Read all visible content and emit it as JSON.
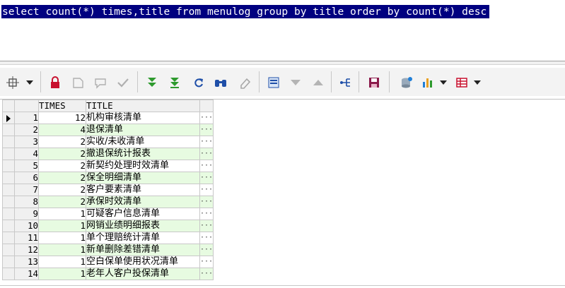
{
  "sql": {
    "query": "select count(*) times,title from menulog group by title order by count(*) desc"
  },
  "toolbar": {
    "icons": [
      "query-settings-icon",
      "lock-icon",
      "new-record-icon",
      "delete-record-icon",
      "post-changes-icon",
      "fetch-next-icon",
      "fetch-last-icon",
      "refresh-icon",
      "find-icon",
      "clear-icon",
      "single-record-icon",
      "sort-desc-icon",
      "sort-asc-icon",
      "export-icon",
      "save-icon",
      "query-by-example-icon",
      "chart-icon",
      "table-view-icon"
    ],
    "accent_green": "#2e9a2e",
    "accent_red": "#c8102e",
    "accent_blue": "#1f4fa8"
  },
  "grid": {
    "columns": [
      "TIMES",
      "TITLE"
    ],
    "rows": [
      {
        "n": "1",
        "times": "12",
        "title": "机构审核清单"
      },
      {
        "n": "2",
        "times": "4",
        "title": "退保清单"
      },
      {
        "n": "3",
        "times": "2",
        "title": "实收/未收清单"
      },
      {
        "n": "4",
        "times": "2",
        "title": "撤退保统计报表"
      },
      {
        "n": "5",
        "times": "2",
        "title": "新契约处理时效清单"
      },
      {
        "n": "6",
        "times": "2",
        "title": "保全明细清单"
      },
      {
        "n": "7",
        "times": "2",
        "title": "客户要素清单"
      },
      {
        "n": "8",
        "times": "2",
        "title": "承保时效清单"
      },
      {
        "n": "9",
        "times": "1",
        "title": "可疑客户信息清单"
      },
      {
        "n": "10",
        "times": "1",
        "title": "网销业绩明细报表"
      },
      {
        "n": "11",
        "times": "1",
        "title": "单个理赔统计清单"
      },
      {
        "n": "12",
        "times": "1",
        "title": "新单删除差错清单"
      },
      {
        "n": "13",
        "times": "1",
        "title": "空白保单使用状况清单"
      },
      {
        "n": "14",
        "times": "1",
        "title": "老年人客户投保清单"
      }
    ],
    "current_row": "1",
    "row_alt_color": "#e7fbe1",
    "cell_button_glyph": "···"
  }
}
